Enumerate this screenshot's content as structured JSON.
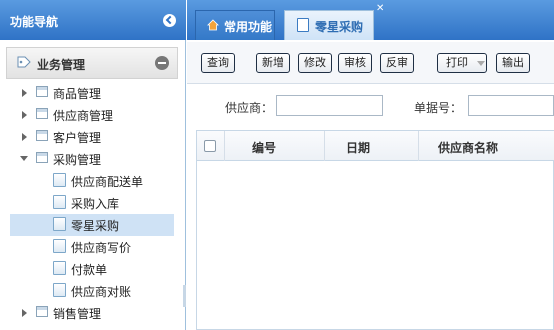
{
  "nav": {
    "title": "功能导航",
    "group": {
      "label": "业务管理"
    },
    "items": [
      {
        "label": "商品管理",
        "level": 1,
        "state": "collapsed"
      },
      {
        "label": "供应商管理",
        "level": 1,
        "state": "collapsed"
      },
      {
        "label": "客户管理",
        "level": 1,
        "state": "collapsed"
      },
      {
        "label": "采购管理",
        "level": 1,
        "state": "expanded"
      },
      {
        "label": "供应商配送单",
        "level": 2
      },
      {
        "label": "采购入库",
        "level": 2
      },
      {
        "label": "零星采购",
        "level": 2,
        "selected": true
      },
      {
        "label": "供应商写价",
        "level": 2
      },
      {
        "label": "付款单",
        "level": 2
      },
      {
        "label": "供应商对账",
        "level": 2
      },
      {
        "label": "销售管理",
        "level": 1,
        "state": "collapsed"
      }
    ]
  },
  "tabs": [
    {
      "label": "常用功能",
      "icon": "home-icon"
    },
    {
      "label": "零星采购",
      "icon": "page-icon",
      "active": true
    }
  ],
  "toolbar": {
    "query": "查询",
    "add": "新增",
    "edit": "修改",
    "approve": "审核",
    "unapprove": "反审",
    "print": "打印",
    "export": "输出"
  },
  "form": {
    "supplier_label": "供应商：",
    "supplier_value": "",
    "docno_label": "单据号：",
    "docno_value": ""
  },
  "grid": {
    "columns": [
      "编号",
      "日期",
      "供应商名称"
    ],
    "rows": []
  },
  "colors": {
    "header_blue": "#2f73c6",
    "selected_row": "#cfe2f5"
  }
}
